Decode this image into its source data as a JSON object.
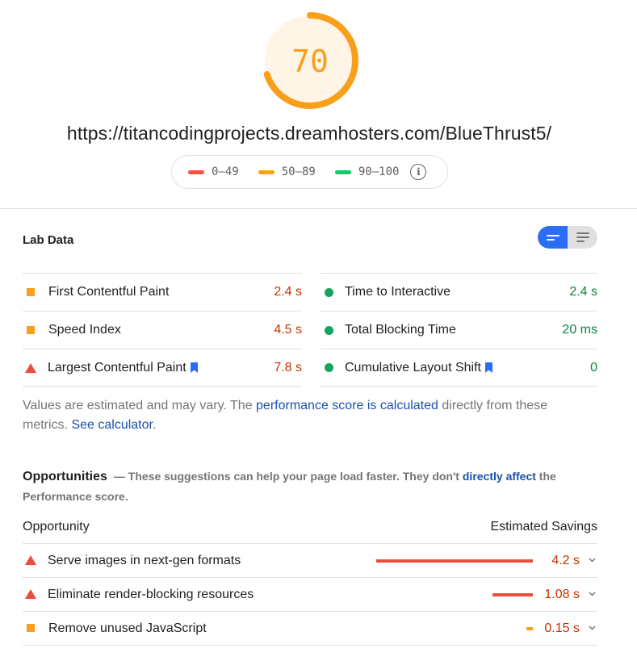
{
  "score": {
    "value": "70",
    "color": "#fa9f1b",
    "fraction": 0.7
  },
  "page_url": "https://titancodingprojects.dreamhosters.com/BlueThrust5/",
  "legend": {
    "items": [
      {
        "label": "0–49",
        "color": "#ff4e42"
      },
      {
        "label": "50–89",
        "color": "#ffa400"
      },
      {
        "label": "90–100",
        "color": "#0cce6b"
      }
    ],
    "info_icon": "info-icon"
  },
  "lab_data": {
    "title": "Lab Data",
    "view_toggle": {
      "active": "summary",
      "icons": [
        "summary-view-icon",
        "list-view-icon"
      ]
    },
    "metrics_left": [
      {
        "name": "First Contentful Paint",
        "value": "2.4 s",
        "status": "average",
        "has_bookmark": false
      },
      {
        "name": "Speed Index",
        "value": "4.5 s",
        "status": "average",
        "has_bookmark": false
      },
      {
        "name": "Largest Contentful Paint",
        "value": "7.8 s",
        "status": "fail",
        "has_bookmark": true
      }
    ],
    "metrics_right": [
      {
        "name": "Time to Interactive",
        "value": "2.4 s",
        "status": "pass",
        "has_bookmark": false
      },
      {
        "name": "Total Blocking Time",
        "value": "20 ms",
        "status": "pass",
        "has_bookmark": false
      },
      {
        "name": "Cumulative Layout Shift",
        "value": "0",
        "status": "pass",
        "has_bookmark": true
      }
    ],
    "note": {
      "prefix": "Values are estimated and may vary. The ",
      "link1": "performance score is calculated",
      "middle": " directly from these metrics. ",
      "link2": "See calculator",
      "suffix": "."
    }
  },
  "opportunities": {
    "title": "Opportunities",
    "desc_prefix": "— These suggestions can help your page load faster. They don't ",
    "desc_link": "directly affect",
    "desc_suffix": " the Performance score.",
    "col_left": "Opportunity",
    "col_right": "Estimated Savings",
    "items": [
      {
        "label": "Serve images in next-gen formats",
        "value": "4.2 s",
        "status": "fail",
        "savings_fraction": 1.0
      },
      {
        "label": "Eliminate render-blocking resources",
        "value": "1.08 s",
        "status": "fail",
        "savings_fraction": 0.257
      },
      {
        "label": "Remove unused JavaScript",
        "value": "0.15 s",
        "status": "average",
        "savings_fraction": 0.04
      }
    ]
  },
  "colors": {
    "fail": "#eb4d3f",
    "average": "#fa9f1b",
    "pass": "#11a65b",
    "link": "#1a52a8",
    "toggle_active": "#2a6ff3"
  }
}
